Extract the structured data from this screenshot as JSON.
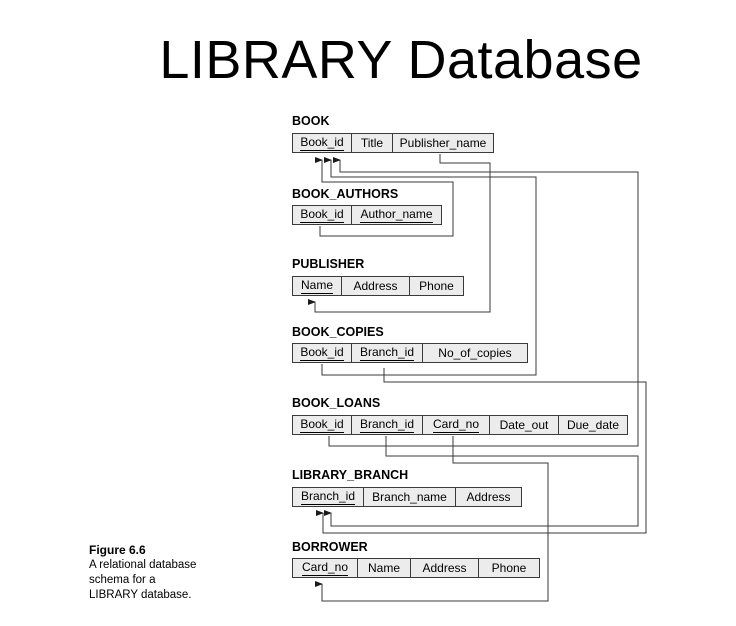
{
  "title": "LIBRARY Database",
  "caption": {
    "figure": "Figure 6.6",
    "line1": "A relational database",
    "line2": "schema for a",
    "line3": "LIBRARY database."
  },
  "relations": {
    "book": {
      "name": "BOOK",
      "attrs": [
        "Book_id",
        "Title",
        "Publisher_name"
      ]
    },
    "book_authors": {
      "name": "BOOK_AUTHORS",
      "attrs": [
        "Book_id",
        "Author_name"
      ]
    },
    "publisher": {
      "name": "PUBLISHER",
      "attrs": [
        "Name",
        "Address",
        "Phone"
      ]
    },
    "book_copies": {
      "name": "BOOK_COPIES",
      "attrs": [
        "Book_id",
        "Branch_id",
        "No_of_copies"
      ]
    },
    "book_loans": {
      "name": "BOOK_LOANS",
      "attrs": [
        "Book_id",
        "Branch_id",
        "Card_no",
        "Date_out",
        "Due_date"
      ]
    },
    "library_branch": {
      "name": "LIBRARY_BRANCH",
      "attrs": [
        "Branch_id",
        "Branch_name",
        "Address"
      ]
    },
    "borrower": {
      "name": "BORROWER",
      "attrs": [
        "Card_no",
        "Name",
        "Address",
        "Phone"
      ]
    }
  },
  "line_color": "#3a3a3a",
  "cell_color": "#ececec"
}
